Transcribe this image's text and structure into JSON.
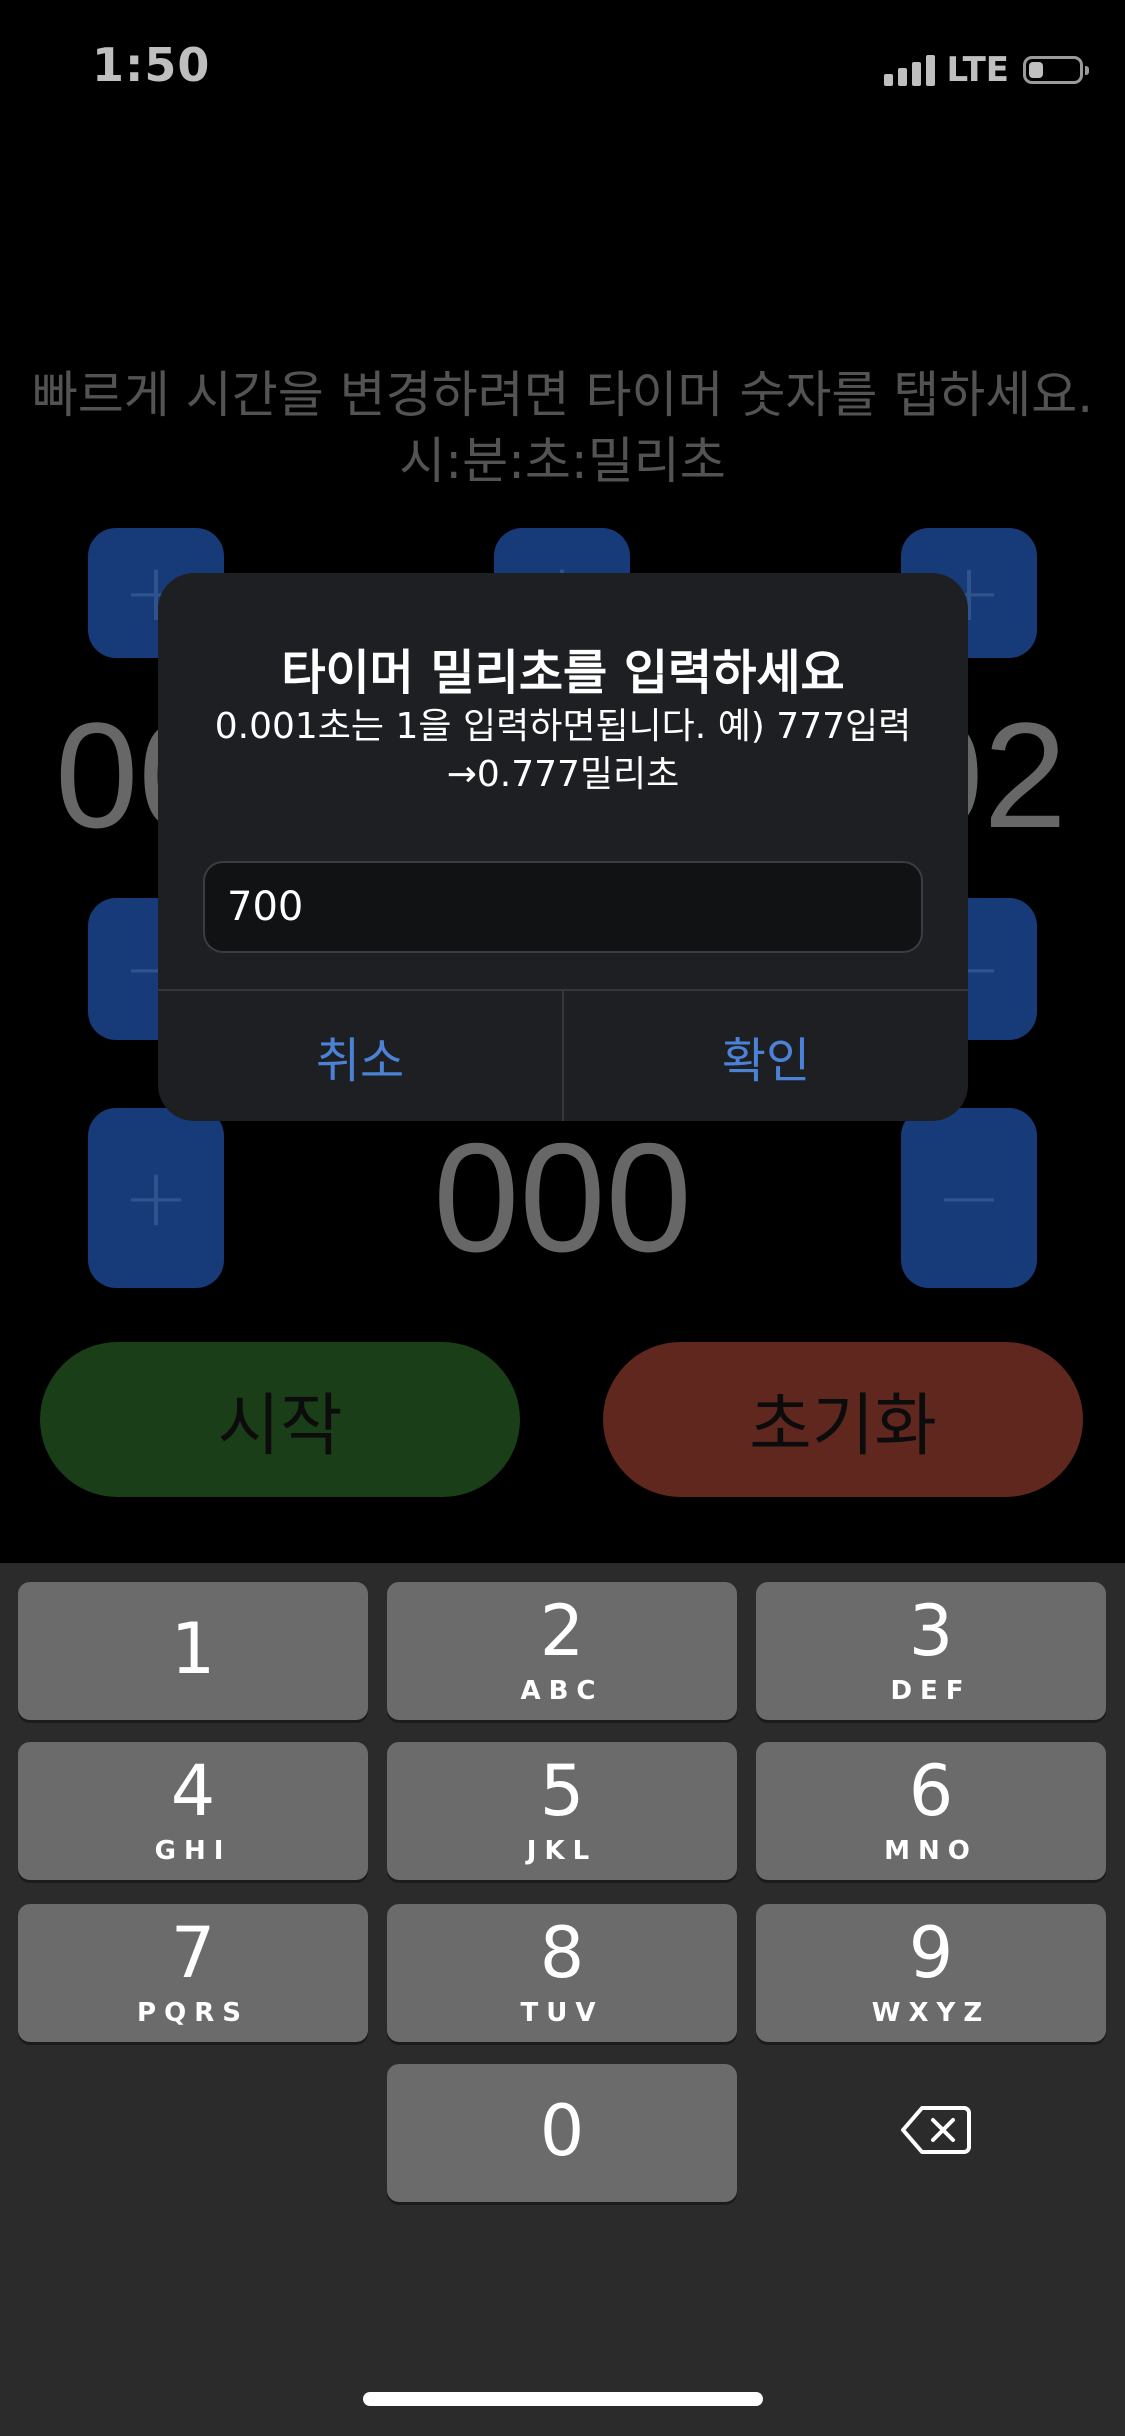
{
  "status_bar": {
    "time": "1:50",
    "network": "LTE",
    "battery_level": 0.3
  },
  "instructions": {
    "line1": "빠르게 시간을 변경하려면 타이머 숫자를 탭하세요.",
    "line2": "시:분:초:밀리초"
  },
  "timer": {
    "left_value": "00",
    "right_value": "02",
    "millis_value": "000"
  },
  "step_buttons": {
    "plus": "+",
    "minus": "−"
  },
  "actions": {
    "start_label": "시작",
    "reset_label": "초기화"
  },
  "dialog": {
    "title": "타이머 밀리초를 입력하세요",
    "message_line1": "0.001초는 1을 입력하면됩니다. 예) 777입력",
    "message_line2": "→0.777밀리초",
    "input_value": "700",
    "cancel_label": "취소",
    "confirm_label": "확인"
  },
  "keyboard": {
    "keys": [
      {
        "digit": "1",
        "letters": ""
      },
      {
        "digit": "2",
        "letters": "ABC"
      },
      {
        "digit": "3",
        "letters": "DEF"
      },
      {
        "digit": "4",
        "letters": "GHI"
      },
      {
        "digit": "5",
        "letters": "JKL"
      },
      {
        "digit": "6",
        "letters": "MNO"
      },
      {
        "digit": "7",
        "letters": "PQRS"
      },
      {
        "digit": "8",
        "letters": "TUV"
      },
      {
        "digit": "9",
        "letters": "WXYZ"
      },
      {
        "digit": "0",
        "letters": ""
      }
    ]
  },
  "colors": {
    "step_button": "#1f4fa0",
    "start_button": "#235320",
    "reset_button": "#7f3427",
    "dialog_action": "#4b82d6"
  }
}
